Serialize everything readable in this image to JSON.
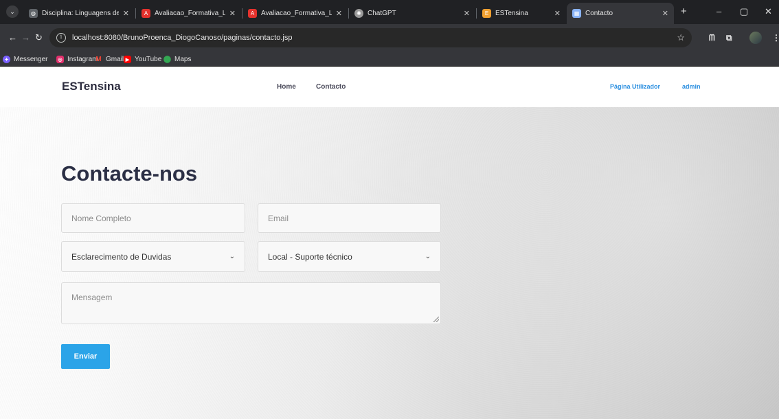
{
  "browser": {
    "tabs": [
      {
        "title": "Disciplina: Linguagens de P",
        "icon": "globe-icon",
        "color": "#5f6368"
      },
      {
        "title": "Avaliacao_Formativa_LPI_LI",
        "icon": "pdf-icon",
        "color": "#e5322d"
      },
      {
        "title": "Avaliacao_Formativa_LPI_LI",
        "icon": "pdf-icon",
        "color": "#e5322d"
      },
      {
        "title": "ChatGPT",
        "icon": "chatgpt-icon",
        "color": "#9a9a9a"
      },
      {
        "title": "ESTensina",
        "icon": "estensina-icon",
        "color": "#f0a030"
      },
      {
        "title": "Contacto",
        "icon": "contacto-icon",
        "color": "#8ab4f8",
        "active": true
      }
    ],
    "new_tab": "+",
    "window": {
      "minimize": "–",
      "maximize": "▢",
      "close": "✕"
    },
    "address": {
      "url": "localhost:8080/BrunoProenca_DiogoCanoso/paginas/contacto.jsp"
    },
    "bookmarks": [
      {
        "label": "Messenger",
        "icon": "messenger-icon",
        "color": "#7b61ff"
      },
      {
        "label": "Instagram",
        "icon": "instagram-icon",
        "color": "#e1306c"
      },
      {
        "label": "Gmail",
        "icon": "gmail-icon",
        "color": "#ea4335"
      },
      {
        "label": "YouTube",
        "icon": "youtube-icon",
        "color": "#ff0000"
      },
      {
        "label": "Maps",
        "icon": "maps-icon",
        "color": "#34a853"
      }
    ]
  },
  "site": {
    "brand": "ESTensina",
    "nav": {
      "home": "Home",
      "contacto": "Contacto"
    },
    "user": {
      "pagina": "Página Utilizador",
      "name": "admin"
    },
    "accent_color": "#2ba4e8"
  },
  "form": {
    "heading": "Contacte-nos",
    "name_placeholder": "Nome Completo",
    "email_placeholder": "Email",
    "subject_value": "Esclarecimento de Duvidas",
    "local_value": "Local - Suporte técnico",
    "message_placeholder": "Mensagem",
    "submit": "Enviar"
  }
}
